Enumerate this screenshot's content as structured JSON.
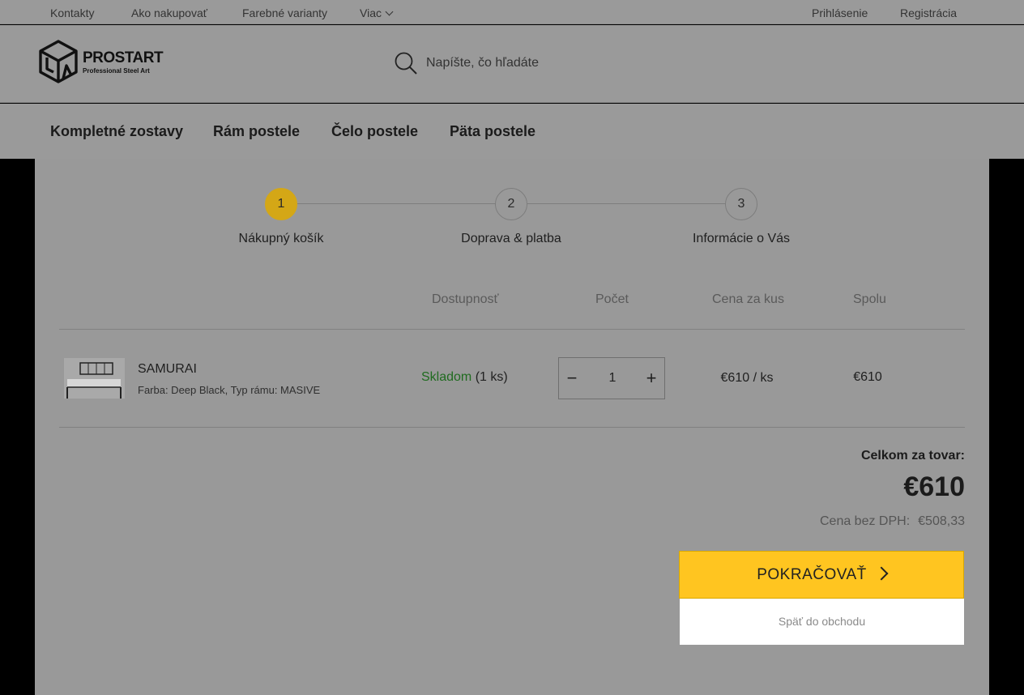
{
  "topbar": {
    "links": [
      "Kontakty",
      "Ako nakupovať",
      "Farebné varianty",
      "Viac"
    ],
    "login": "Prihlásenie",
    "register": "Registrácia"
  },
  "header": {
    "brand": "PROSTART",
    "tagline": "Professional Steel Art",
    "search_placeholder": "Napíšte, čo hľadáte"
  },
  "nav": [
    "Kompletné zostavy",
    "Rám postele",
    "Čelo postele",
    "Päta postele"
  ],
  "steps": [
    {
      "num": "1",
      "label": "Nákupný košík",
      "active": true
    },
    {
      "num": "2",
      "label": "Doprava & platba",
      "active": false
    },
    {
      "num": "3",
      "label": "Informácie o Vás",
      "active": false
    }
  ],
  "cart": {
    "columns": [
      "Dostupnosť",
      "Počet",
      "Cena za kus",
      "Spolu"
    ],
    "item": {
      "name": "SAMURAI",
      "variant": "Farba: Deep Black, Typ rámu: MASIVE",
      "stock_status": "Skladom",
      "stock_qty": "(1 ks)",
      "quantity": "1",
      "unit_price": "€610 / ks",
      "total": "€610"
    }
  },
  "summary": {
    "label": "Celkom za tovar:",
    "value": "€610",
    "net_label": "Cena bez DPH:",
    "net_value": "€508,33"
  },
  "actions": {
    "continue": "POKRAČOVAŤ",
    "back": "Späť do obchodu"
  },
  "colors": {
    "accent": "#ffc520",
    "active_step": "#d4a716",
    "stock_ok": "#1f6b1f"
  }
}
